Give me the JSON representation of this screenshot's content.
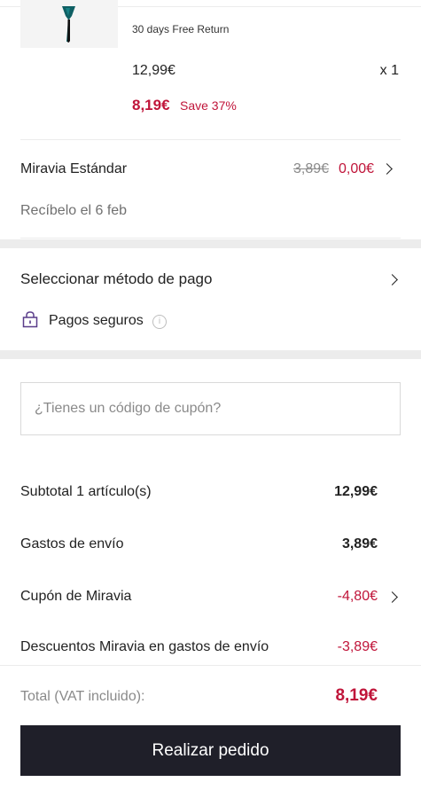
{
  "product": {
    "returns_label": "30 days Free Return",
    "price": "12,99€",
    "quantity": "x 1",
    "sale_price": "8,19€",
    "save_label": "Save 37%"
  },
  "shipping": {
    "method": "Miravia Estándar",
    "old_price": "3,89€",
    "new_price": "0,00€",
    "delivery": "Recíbelo el 6 feb"
  },
  "payment": {
    "title": "Seleccionar método de pago",
    "secure_label": "Pagos seguros",
    "info_glyph": "i"
  },
  "coupon": {
    "placeholder": "¿Tienes un código de cupón?"
  },
  "summary": {
    "rows": [
      {
        "label": "Subtotal 1 artículo(s)",
        "value": "12,99€"
      },
      {
        "label": "Gastos de envío",
        "value": "3,89€"
      },
      {
        "label": "Cupón de Miravia",
        "value": "-4,80€"
      },
      {
        "label": "Descuentos Miravia en gastos de envío",
        "value": "-3,89€"
      }
    ],
    "total_label": "Total (VAT incluido):",
    "total_value": "8,19€"
  },
  "cta": {
    "label": "Realizar pedido"
  },
  "colors": {
    "accent": "#c0153a",
    "button": "#1f1f29",
    "muted": "#8a8a8a"
  },
  "icons": [
    "product-thumbnail",
    "chevron-right-icon",
    "lock-icon",
    "info-icon"
  ]
}
